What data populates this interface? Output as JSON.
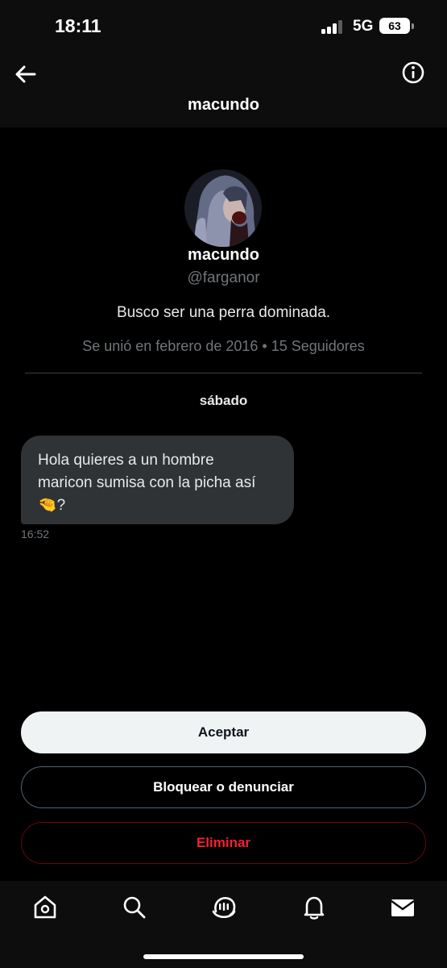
{
  "status_bar": {
    "time": "18:11",
    "network": "5G",
    "battery": "63"
  },
  "header": {
    "title": "macundo",
    "back_icon": "arrow-left-icon",
    "info_icon": "info-circle-icon"
  },
  "profile": {
    "name": "macundo",
    "handle": "@farganor",
    "bio": "Busco ser una perra dominada.",
    "meta": "Se unió en febrero de 2016 • 15 Seguidores"
  },
  "conversation": {
    "day_label": "sábado",
    "message": {
      "line1": "Hola quieres a un hombre",
      "line2": "maricon sumisa con la picha así",
      "emoji": "🤏",
      "line3_suffix": "?",
      "time": "16:52"
    }
  },
  "actions": {
    "accept": "Aceptar",
    "block_report": "Bloquear o denunciar",
    "delete": "Eliminar"
  },
  "bottom_nav": {
    "items": [
      "home-icon",
      "search-icon",
      "grok-icon",
      "notifications-bell-icon",
      "messages-envelope-icon"
    ]
  },
  "colors": {
    "background": "#000000",
    "bubble": "#2f3336",
    "muted_text": "#71767b",
    "accept_bg": "#eff3f4",
    "delete_text": "#f4212e"
  }
}
